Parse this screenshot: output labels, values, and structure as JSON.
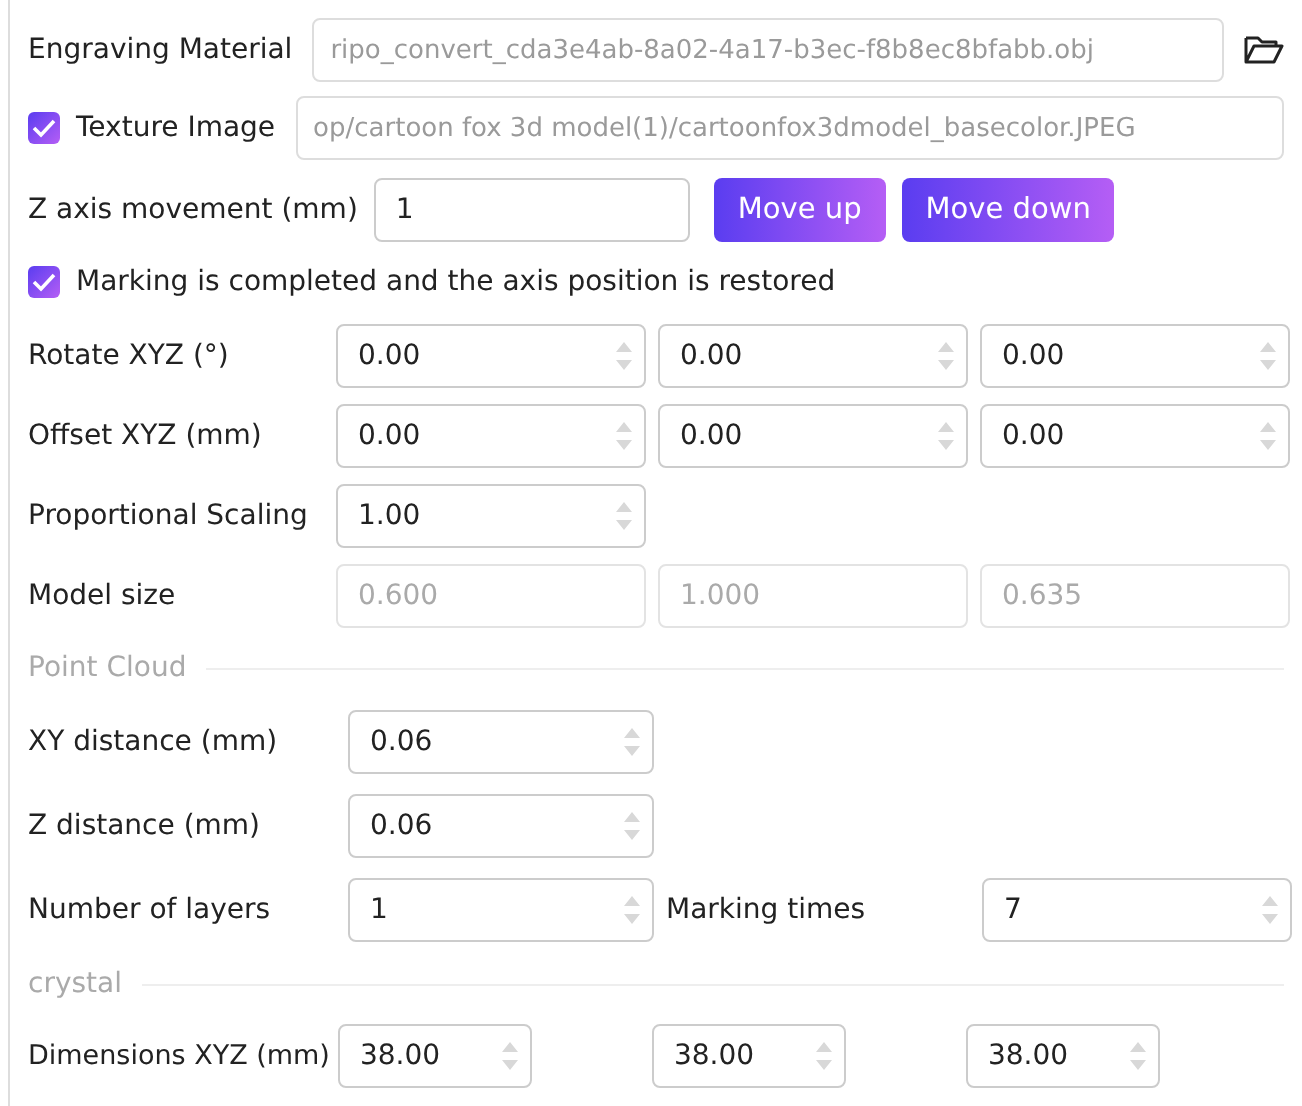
{
  "engraving_material": {
    "label": "Engraving Material",
    "value": "ripo_convert_cda3e4ab-8a02-4a17-b3ec-f8b8ec8bfabb.obj"
  },
  "texture_image": {
    "label": "Texture Image",
    "checked": true,
    "value": "op/cartoon fox 3d model(1)/cartoonfox3dmodel_basecolor.JPEG"
  },
  "z_axis": {
    "label": "Z axis movement (mm)",
    "value": "1",
    "buttons": [
      "Move up",
      "Move down"
    ]
  },
  "restore_axis": {
    "label": "Marking is completed and the axis position is restored",
    "checked": true
  },
  "transform_rows": [
    {
      "label": "Rotate XYZ (°)",
      "kind": "spin",
      "values": [
        "0.00",
        "0.00",
        "0.00"
      ]
    },
    {
      "label": "Offset XYZ (mm)",
      "kind": "spin",
      "values": [
        "0.00",
        "0.00",
        "0.00"
      ]
    },
    {
      "label": "Proportional Scaling",
      "kind": "spin",
      "values": [
        "1.00"
      ]
    },
    {
      "label": "Model size",
      "kind": "readonly",
      "values": [
        "0.600",
        "1.000",
        "0.635"
      ]
    }
  ],
  "point_cloud": {
    "title": "Point Cloud",
    "rows": [
      {
        "label": "XY distance (mm)",
        "value": "0.06"
      },
      {
        "label": "Z distance (mm)",
        "value": "0.06"
      },
      {
        "label": "Number of layers",
        "value": "1",
        "extra": {
          "label": "Marking times",
          "value": "7"
        }
      }
    ]
  },
  "crystal": {
    "title": "crystal",
    "dimensions": {
      "label": "Dimensions XYZ (mm)",
      "values": [
        "38.00",
        "38.00",
        "38.00"
      ]
    }
  }
}
